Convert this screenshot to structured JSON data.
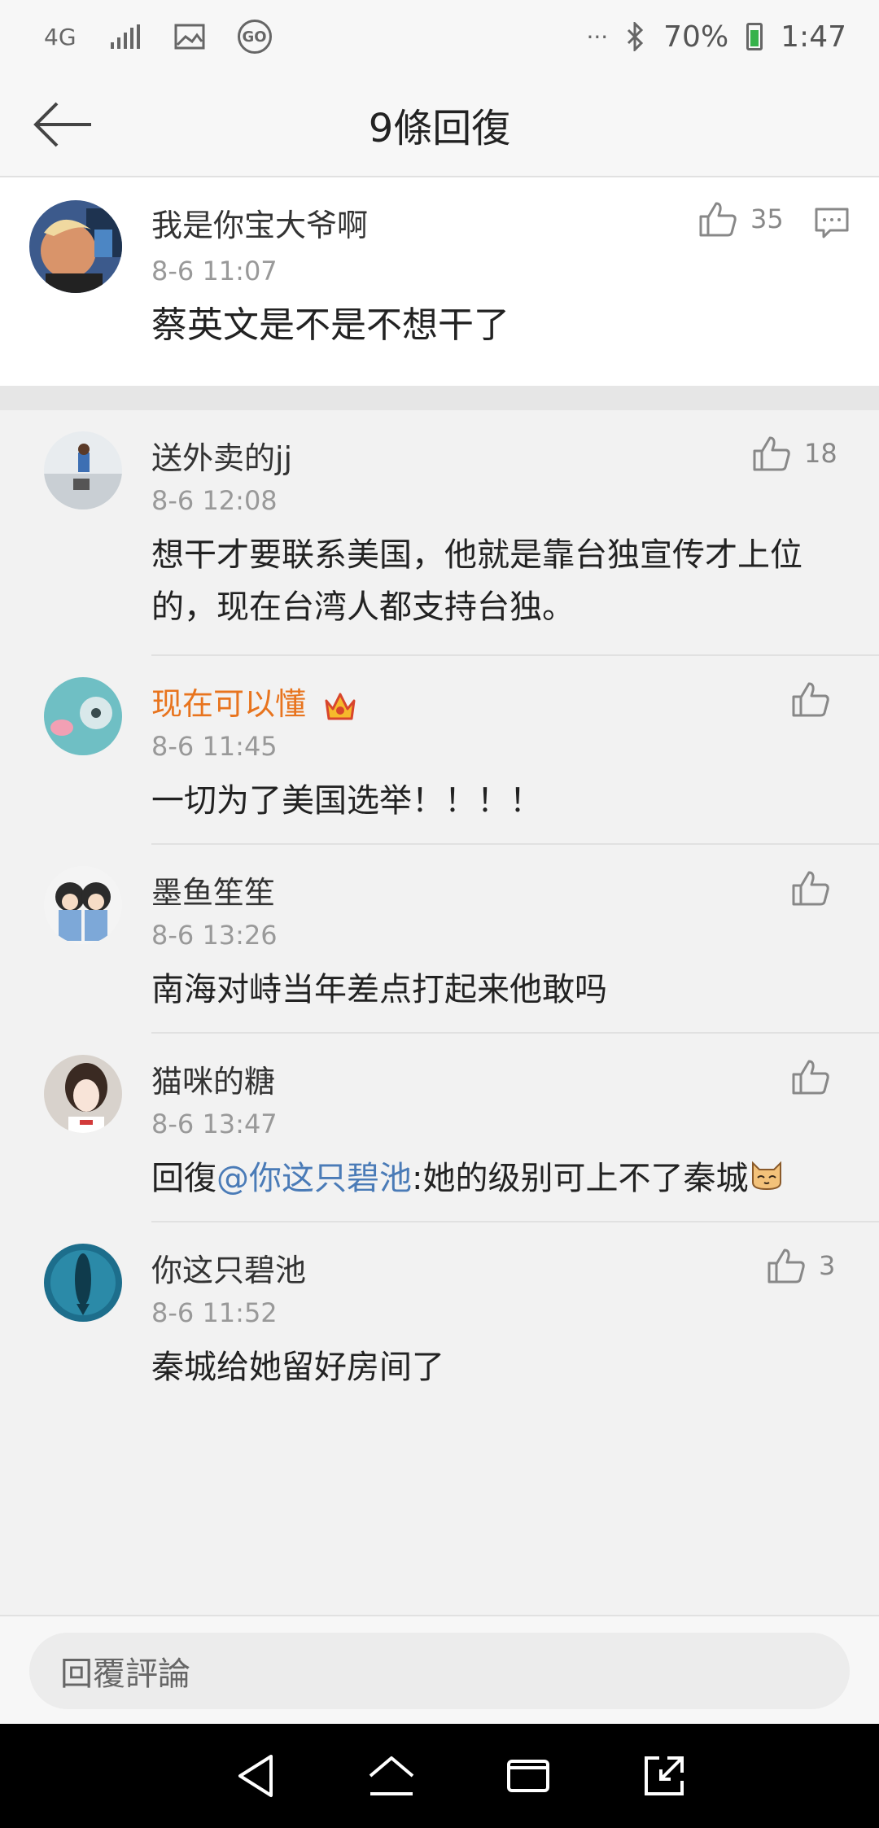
{
  "status_bar": {
    "network": "4G",
    "battery": "70%",
    "time": "1:47",
    "dots": "···"
  },
  "header": {
    "title": "9條回復"
  },
  "main_comment": {
    "name": "我是你宝大爷啊",
    "time": "8-6 11:07",
    "content": "蔡英文是不是不想干了",
    "likes": "35"
  },
  "replies": [
    {
      "name": "送外卖的jj",
      "time": "8-6 12:08",
      "content": "想干才要联系美国，他就是靠台独宣传才上位的，现在台湾人都支持台独。",
      "likes": "18",
      "vip": false
    },
    {
      "name": "现在可以懂",
      "time": "8-6 11:45",
      "content": "一切为了美国选举！！！！",
      "likes": "",
      "vip": true
    },
    {
      "name": "墨鱼笙笙",
      "time": "8-6 13:26",
      "content": "南海对峙当年差点打起来他敢吗",
      "likes": "",
      "vip": false
    },
    {
      "name": "猫咪的糖",
      "time": "8-6 13:47",
      "content_prefix": "回復",
      "mention": "@你这只碧池",
      "content_suffix": ":她的级别可上不了秦城",
      "likes": "",
      "vip": false
    },
    {
      "name": "你这只碧池",
      "time": "8-6 11:52",
      "content": "秦城给她留好房间了",
      "likes": "3",
      "vip": false
    }
  ],
  "reply_bar": {
    "placeholder": "回覆評論"
  },
  "colors": {
    "vip_name": "#e8741e",
    "mention": "#4a7bb7",
    "battery_green": "#36b24a"
  }
}
